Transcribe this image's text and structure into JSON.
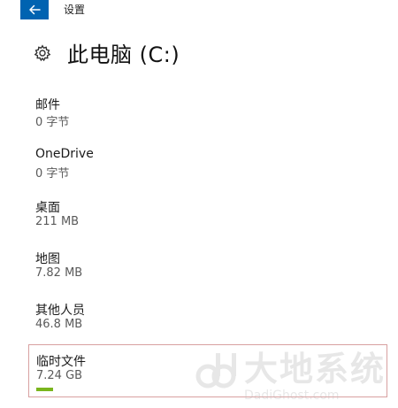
{
  "window": {
    "title": "设置",
    "back_icon": "back-arrow-icon",
    "accent_color": "#0063b1"
  },
  "header": {
    "icon": "gear-icon",
    "title": "此电脑 (C:)"
  },
  "items": [
    {
      "label": "邮件",
      "size": "0 字节"
    },
    {
      "label": "OneDrive",
      "size": "0 字节"
    },
    {
      "label": "桌面",
      "size": "211 MB"
    },
    {
      "label": "地图",
      "size": "7.82 MB"
    },
    {
      "label": "其他人员",
      "size": "46.8 MB"
    },
    {
      "label": "临时文件",
      "size": "7.24 GB",
      "usage_fraction": 0.05,
      "selected": true
    }
  ],
  "watermark": {
    "text_cn": "大地系统",
    "text_en": "DadiGhost.com"
  },
  "colors": {
    "usage_bar": "#7ab51d",
    "selection_border": "#d8a0a0"
  }
}
